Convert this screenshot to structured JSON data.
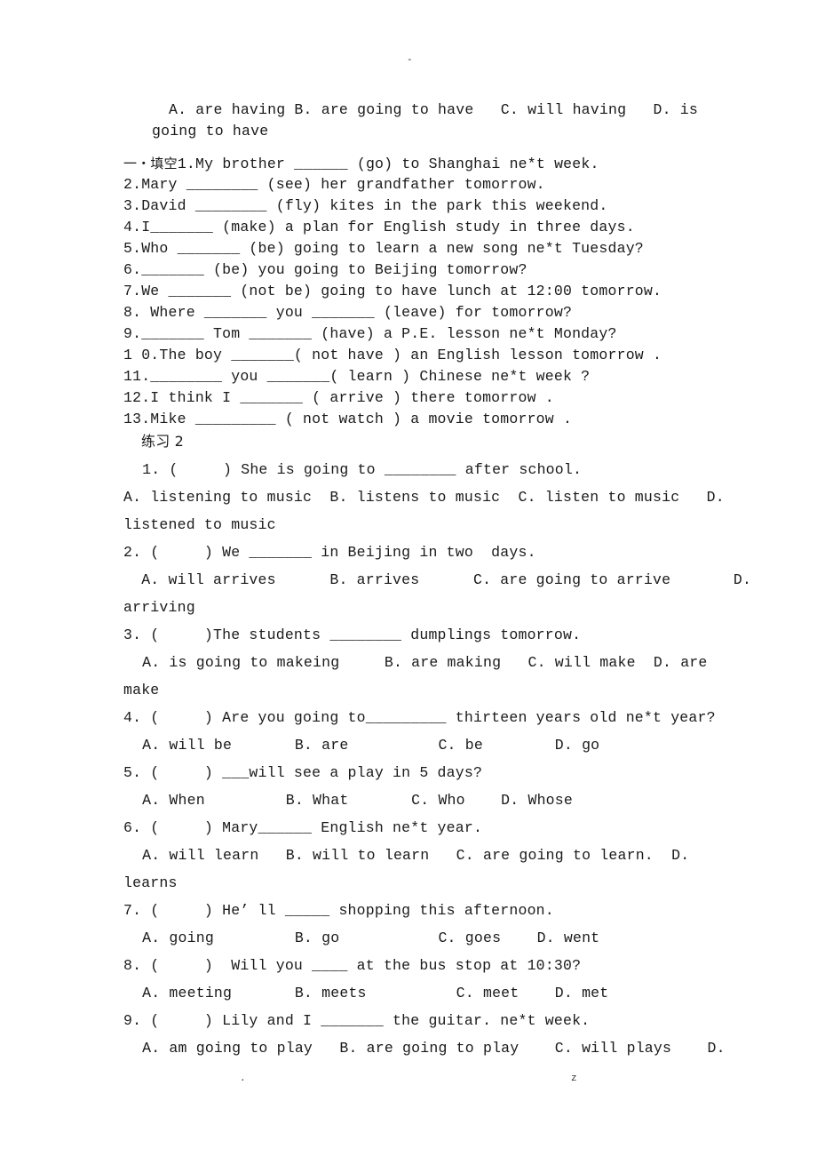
{
  "header_mark": "-",
  "footer": {
    "left": ".",
    "right": "z"
  },
  "intro_options": {
    "line1": "A. are having B. are going to have   C. will having   D. is",
    "line2": "going to have"
  },
  "section1": {
    "title": "一・填空",
    "items": [
      "1.My brother ______ (go) to Shanghai ne*t week.",
      "2.Mary ________ (see) her grandfather tomorrow.",
      "3.David ________ (fly) kites in the park this weekend.",
      "4.I_______ (make) a plan for English study in three days.",
      "5.Who _______ (be) going to learn a new song ne*t Tuesday?",
      "6._______ (be) you going to Beijing tomorrow?",
      "7.We _______ (not be) going to have lunch at 12:00 tomorrow.",
      "8. Where _______ you _______ (leave) for tomorrow?",
      "9._______ Tom _______ (have) a P.E. lesson ne*t Monday?",
      "1 0.The boy _______( not have ) an English lesson tomorrow .",
      "11.________ you _______( learn ) Chinese ne*t week ?",
      "12.I think I _______ ( arrive ) there tomorrow .",
      "13.Mike _________ ( not watch ) a movie tomorrow ."
    ]
  },
  "section2": {
    "title": "练习 2",
    "lines": [
      " 1. (     ) She is going to ________ after school.",
      "A. listening to music  B. listens to music  C. listen to music   D.",
      "listened to music",
      "2. (     ) We _______ in Beijing in two  days.",
      "  A. will arrives      B. arrives      C. are going to arrive       D.",
      "arriving",
      "3. (     )The students ________ dumplings tomorrow.",
      " A. is going to makeing     B. are making   C. will make  D. are",
      "make",
      "4. (     ) Are you going to_________ thirteen years old ne*t year?",
      " A. will be       B. are          C. be        D. go",
      "5. (     ) ___will see a play in 5 days?",
      " A. When         B. What       C. Who    D. Whose",
      "6. (     ) Mary______ English ne*t year.",
      " A. will learn   B. will to learn   C. are going to learn.  D.",
      "learns",
      "7. (     ) He’ ll _____ shopping this afternoon.",
      " A. going         B. go           C. goes    D. went",
      "8. (     )  Will you ____ at the bus stop at 10:30?",
      " A. meeting       B. meets          C. meet    D. met",
      "9. (     ) Lily and I _______ the guitar. ne*t week.",
      " A. am going to play   B. are going to play    C. will plays    D."
    ]
  }
}
